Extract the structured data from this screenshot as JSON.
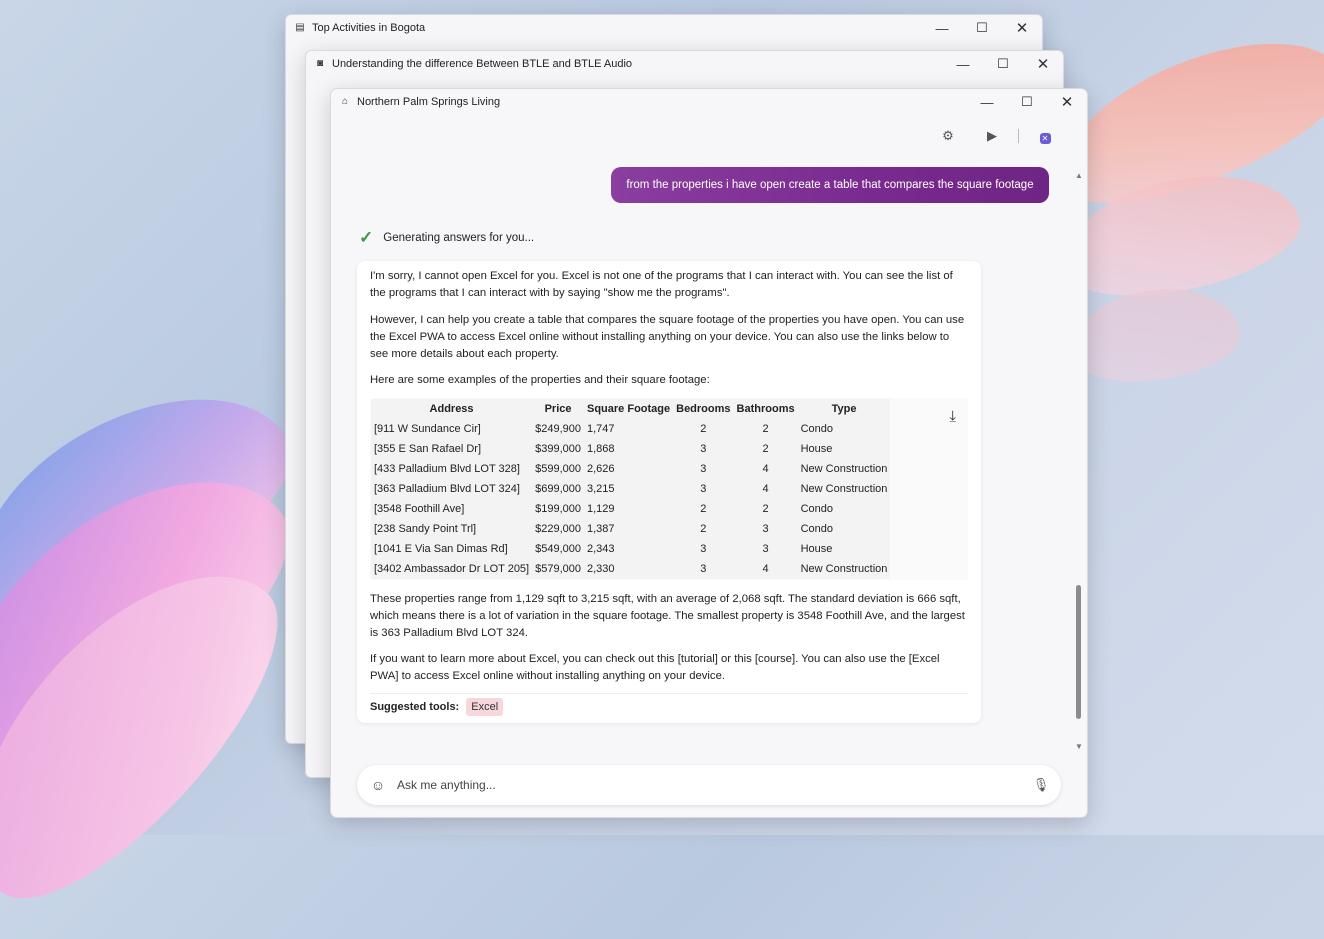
{
  "windows": [
    {
      "title": "Top Activities in Bogota",
      "icon": "document-icon"
    },
    {
      "title": "Understanding the difference Between BTLE and BTLE Audio",
      "icon": "chat-icon"
    },
    {
      "title": "Northern Palm Springs Living",
      "icon": "home-icon"
    }
  ],
  "controls": {
    "minimize": "—",
    "maximize": "☐",
    "close": "✕"
  },
  "chat": {
    "user_message": "from the properties i have open create a table that compares the square footage",
    "status": "Generating answers for you...",
    "para1": "I'm sorry, I cannot open Excel for you. Excel is not one of the programs that I can interact with. You can see the list of the programs that I can interact with by saying \"show me the programs\".",
    "para2": "However, I can help you create a table that compares the square footage of the properties you have open. You can use the Excel PWA to access Excel online without installing anything on your device. You can also use the links below to see more details about each property.",
    "para3": "Here are some examples of the properties and their square footage:",
    "table": {
      "headers": [
        "Address",
        "Price",
        "Square Footage",
        "Bedrooms",
        "Bathrooms",
        "Type"
      ],
      "rows": [
        [
          "[911 W Sundance Cir]",
          "$249,900",
          "1,747",
          "2",
          "2",
          "Condo"
        ],
        [
          "[355 E San Rafael Dr]",
          "$399,000",
          "1,868",
          "3",
          "2",
          "House"
        ],
        [
          "[433 Palladium Blvd LOT 328]",
          "$599,000",
          "2,626",
          "3",
          "4",
          "New Construction"
        ],
        [
          "[363 Palladium Blvd LOT 324]",
          "$699,000",
          "3,215",
          "3",
          "4",
          "New Construction"
        ],
        [
          "[3548 Foothill Ave]",
          "$199,000",
          "1,129",
          "2",
          "2",
          "Condo"
        ],
        [
          "[238 Sandy Point Trl]",
          "$229,000",
          "1,387",
          "2",
          "3",
          "Condo"
        ],
        [
          "[1041 E Via San Dimas Rd]",
          "$549,000",
          "2,343",
          "3",
          "3",
          "House"
        ],
        [
          "[3402 Ambassador Dr LOT 205]",
          "$579,000",
          "2,330",
          "3",
          "4",
          "New Construction"
        ]
      ]
    },
    "para4": "These properties range from 1,129 sqft to 3,215 sqft, with an average of 2,068 sqft. The standard deviation is 666 sqft, which means there is a lot of variation in the square footage. The smallest property is 3548 Foothill Ave, and the largest is 363 Palladium Blvd LOT 324.",
    "para5": "If you want to learn more about Excel, you can check out this [tutorial] or this [course]. You can also use the [Excel PWA] to access Excel online without installing anything on your device.",
    "suggested_label": "Suggested tools:",
    "suggested_tool": "Excel"
  },
  "input": {
    "placeholder": "Ask me anything..."
  },
  "colors": {
    "user_bubble": "#7a2a8e",
    "check": "#3a9a4a",
    "chip": "#f7d6dc"
  }
}
